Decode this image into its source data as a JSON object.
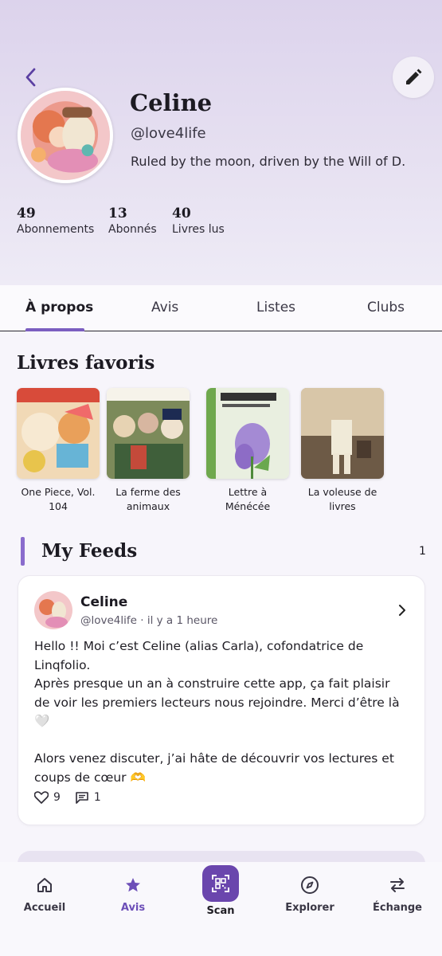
{
  "profile": {
    "name": "Celine",
    "handle": "@love4life",
    "bio": "Ruled by the moon, driven by the Will of D."
  },
  "stats": [
    {
      "value": "49",
      "label": "Abonnements"
    },
    {
      "value": "13",
      "label": "Abonnés"
    },
    {
      "value": "40",
      "label": "Livres lus"
    }
  ],
  "tabs": [
    {
      "label": "À propos",
      "active": true
    },
    {
      "label": "Avis"
    },
    {
      "label": "Listes"
    },
    {
      "label": "Clubs"
    }
  ],
  "favorites": {
    "title": "Livres favoris",
    "books": [
      {
        "title_line1": "One Piece, Vol.",
        "title_line2": "104"
      },
      {
        "title_line1": "La ferme des",
        "title_line2": "animaux"
      },
      {
        "title_line1": "Lettre à",
        "title_line2": "Ménécée"
      },
      {
        "title_line1": "La voleuse de",
        "title_line2": "livres"
      }
    ]
  },
  "feeds": {
    "title": "My Feeds",
    "count": "1",
    "post": {
      "author": "Celine",
      "meta": "@love4life · il y a 1 heure",
      "lines": [
        "Hello !! Moi c’est Celine (alias Carla), cofondatrice de",
        "Linqfolio.",
        "Après presque un an à construire cette app, ça fait plaisir",
        "de voir les premiers lecteurs nous rejoindre. Merci d’être là",
        "🤍",
        "",
        "Alors venez discuter, j’ai hâte de découvrir vos lectures et",
        "coups de cœur 🫶"
      ],
      "likes": "9",
      "comments": "1"
    }
  },
  "nav": {
    "items": [
      {
        "label": "Accueil"
      },
      {
        "label": "Avis"
      },
      {
        "label": "Scan"
      },
      {
        "label": "Explorer"
      },
      {
        "label": "Échange"
      }
    ]
  },
  "colors": {
    "accent": "#6a46ad",
    "header_bg": "#dcd3ec"
  }
}
